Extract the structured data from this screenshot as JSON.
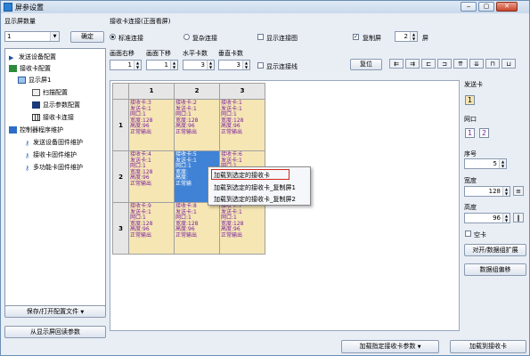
{
  "window": {
    "title": "屏参设置"
  },
  "left": {
    "display_count_label": "显示屏数量",
    "display_count_value": "1",
    "confirm_label": "确定",
    "tree": [
      {
        "label": "发送设备配置",
        "level": 0
      },
      {
        "label": "接收卡配置",
        "level": 0
      },
      {
        "label": "显示屏1",
        "level": 1
      },
      {
        "label": "扫描配置",
        "level": 2
      },
      {
        "label": "显示参数配置",
        "level": 2
      },
      {
        "label": "接收卡连接",
        "level": 2
      },
      {
        "label": "控制器程序维护",
        "level": 0
      },
      {
        "label": "发送设备固件维护",
        "level": 1
      },
      {
        "label": "接收卡固件维护",
        "level": 1
      },
      {
        "label": "多功能卡固件维护",
        "level": 1
      }
    ],
    "save_open_label": "保存/打开配置文件",
    "readback_label": "从显示屏回读参数"
  },
  "main": {
    "header": "接收卡连接(正面看屏)",
    "std_label": "标准连接",
    "complex_label": "复杂连接",
    "show_conn_diagram": "显示连接图",
    "copy_screen": "复制屏",
    "copy_screen_value": "2",
    "screen_unit": "屏",
    "labels": {
      "right_move": "画面右移",
      "down_move": "画面下移",
      "h_count": "水平卡数",
      "v_count": "垂直卡数"
    },
    "values": {
      "right_move": "1",
      "down_move": "1",
      "h_count": "3",
      "v_count": "3"
    },
    "show_conn_lines": "显示连接线",
    "reset_label": "复位",
    "col_headers": [
      "1",
      "2",
      "3"
    ],
    "row_headers": [
      "1",
      "2",
      "3"
    ],
    "cells": [
      [
        "接收卡:3\n发送卡:1\n网口:1\n宽度:128\n高度:96\n正常输出",
        "接收卡:2\n发送卡:1\n网口:1\n宽度:128\n高度:96\n正常输出",
        "接收卡:1\n发送卡:1\n网口:1\n宽度:128\n高度:96\n正常输出"
      ],
      [
        "接收卡:4\n发送卡:1\n网口:1\n宽度:128\n高度:96\n正常输出",
        "接收卡:5\n发送卡:1\n网口:1\n宽度:\n高度:\n正常输",
        "接收卡:6\n发送卡:1\n网口:1\n宽度:\n高度:\n正常"
      ],
      [
        "接收卡:9\n发送卡:1\n网口:1\n宽度:128\n高度:96\n正常输出",
        "接收卡:8\n发送卡:1\n网口:1\n宽度:128\n高度:96\n正常输出",
        "接收卡:7\n发送卡:1\n网口:1\n宽度:128\n高度:96\n正常输出"
      ]
    ],
    "context_menu": [
      "加载到选定的接收卡",
      "加载到选定的接收卡_复制屏1",
      "加载到选定的接收卡_复制屏2"
    ],
    "load_specified_label": "加载指定接收卡参数",
    "load_to_card_label": "加载到接收卡"
  },
  "right": {
    "send_card_label": "发送卡",
    "send_card_value": "1",
    "port_label": "网口",
    "port_values": [
      "1",
      "2"
    ],
    "seq_label": "序号",
    "seq_value": "5",
    "width_label": "宽度",
    "width_value": "128",
    "height_label": "高度",
    "height_value": "96",
    "empty_card_label": "空卡",
    "align_expand_label": "对开/数据组扩展",
    "data_shift_label": "数据组偏移"
  }
}
